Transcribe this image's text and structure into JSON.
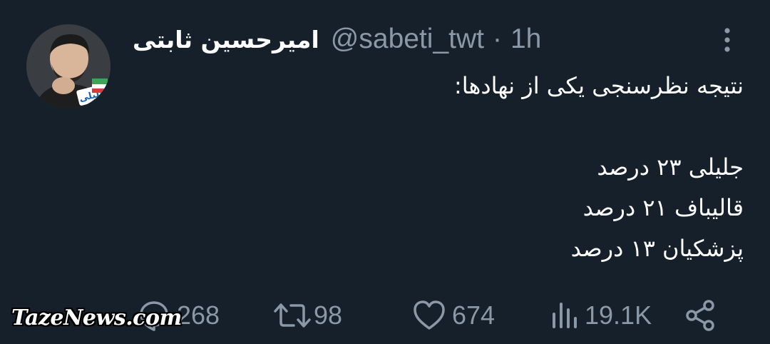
{
  "tweet": {
    "display_name": "امیرحسین ثابتی",
    "handle": "@sabeti_twt",
    "separator": "·",
    "time": "1h",
    "avatar_badge_text": "جلیلی",
    "lines": [
      "نتیجه نظرسنجی یکی از نهادها:",
      "",
      "جلیلی ۲۳ درصد",
      "قالیباف ۲۱ درصد",
      "پزشکیان ۱۳ درصد"
    ]
  },
  "actions": {
    "replies": "268",
    "retweets": "98",
    "likes": "674",
    "views": "19.1K"
  },
  "icons": {
    "more": "more-vertical-icon",
    "reply": "reply-icon",
    "retweet": "retweet-icon",
    "like": "heart-icon",
    "views": "views-icon",
    "share": "share-icon"
  },
  "watermark": "TazeNews.com",
  "colors": {
    "background": "#15202b",
    "text": "#ffffff",
    "secondary": "#8b98a5",
    "badge_blue": "#1a63b5"
  }
}
